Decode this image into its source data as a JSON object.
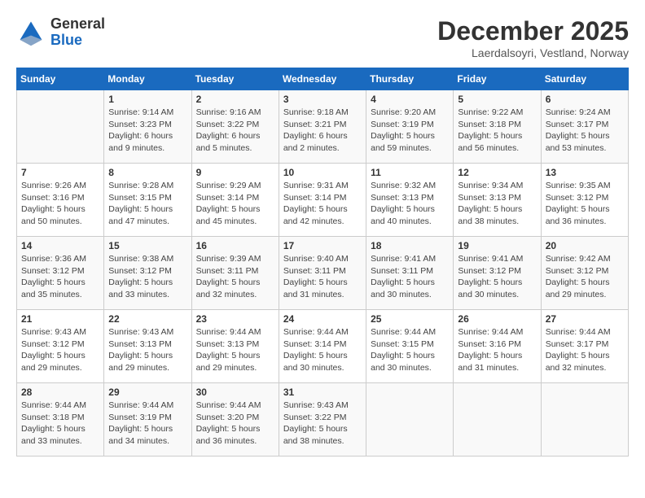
{
  "header": {
    "logo_line1": "General",
    "logo_line2": "Blue",
    "month_title": "December 2025",
    "subtitle": "Laerdalsoyri, Vestland, Norway"
  },
  "calendar": {
    "days_of_week": [
      "Sunday",
      "Monday",
      "Tuesday",
      "Wednesday",
      "Thursday",
      "Friday",
      "Saturday"
    ],
    "weeks": [
      [
        {
          "day": "",
          "info": ""
        },
        {
          "day": "1",
          "info": "Sunrise: 9:14 AM\nSunset: 3:23 PM\nDaylight: 6 hours\nand 9 minutes."
        },
        {
          "day": "2",
          "info": "Sunrise: 9:16 AM\nSunset: 3:22 PM\nDaylight: 6 hours\nand 5 minutes."
        },
        {
          "day": "3",
          "info": "Sunrise: 9:18 AM\nSunset: 3:21 PM\nDaylight: 6 hours\nand 2 minutes."
        },
        {
          "day": "4",
          "info": "Sunrise: 9:20 AM\nSunset: 3:19 PM\nDaylight: 5 hours\nand 59 minutes."
        },
        {
          "day": "5",
          "info": "Sunrise: 9:22 AM\nSunset: 3:18 PM\nDaylight: 5 hours\nand 56 minutes."
        },
        {
          "day": "6",
          "info": "Sunrise: 9:24 AM\nSunset: 3:17 PM\nDaylight: 5 hours\nand 53 minutes."
        }
      ],
      [
        {
          "day": "7",
          "info": "Sunrise: 9:26 AM\nSunset: 3:16 PM\nDaylight: 5 hours\nand 50 minutes."
        },
        {
          "day": "8",
          "info": "Sunrise: 9:28 AM\nSunset: 3:15 PM\nDaylight: 5 hours\nand 47 minutes."
        },
        {
          "day": "9",
          "info": "Sunrise: 9:29 AM\nSunset: 3:14 PM\nDaylight: 5 hours\nand 45 minutes."
        },
        {
          "day": "10",
          "info": "Sunrise: 9:31 AM\nSunset: 3:14 PM\nDaylight: 5 hours\nand 42 minutes."
        },
        {
          "day": "11",
          "info": "Sunrise: 9:32 AM\nSunset: 3:13 PM\nDaylight: 5 hours\nand 40 minutes."
        },
        {
          "day": "12",
          "info": "Sunrise: 9:34 AM\nSunset: 3:13 PM\nDaylight: 5 hours\nand 38 minutes."
        },
        {
          "day": "13",
          "info": "Sunrise: 9:35 AM\nSunset: 3:12 PM\nDaylight: 5 hours\nand 36 minutes."
        }
      ],
      [
        {
          "day": "14",
          "info": "Sunrise: 9:36 AM\nSunset: 3:12 PM\nDaylight: 5 hours\nand 35 minutes."
        },
        {
          "day": "15",
          "info": "Sunrise: 9:38 AM\nSunset: 3:12 PM\nDaylight: 5 hours\nand 33 minutes."
        },
        {
          "day": "16",
          "info": "Sunrise: 9:39 AM\nSunset: 3:11 PM\nDaylight: 5 hours\nand 32 minutes."
        },
        {
          "day": "17",
          "info": "Sunrise: 9:40 AM\nSunset: 3:11 PM\nDaylight: 5 hours\nand 31 minutes."
        },
        {
          "day": "18",
          "info": "Sunrise: 9:41 AM\nSunset: 3:11 PM\nDaylight: 5 hours\nand 30 minutes."
        },
        {
          "day": "19",
          "info": "Sunrise: 9:41 AM\nSunset: 3:12 PM\nDaylight: 5 hours\nand 30 minutes."
        },
        {
          "day": "20",
          "info": "Sunrise: 9:42 AM\nSunset: 3:12 PM\nDaylight: 5 hours\nand 29 minutes."
        }
      ],
      [
        {
          "day": "21",
          "info": "Sunrise: 9:43 AM\nSunset: 3:12 PM\nDaylight: 5 hours\nand 29 minutes."
        },
        {
          "day": "22",
          "info": "Sunrise: 9:43 AM\nSunset: 3:13 PM\nDaylight: 5 hours\nand 29 minutes."
        },
        {
          "day": "23",
          "info": "Sunrise: 9:44 AM\nSunset: 3:13 PM\nDaylight: 5 hours\nand 29 minutes."
        },
        {
          "day": "24",
          "info": "Sunrise: 9:44 AM\nSunset: 3:14 PM\nDaylight: 5 hours\nand 30 minutes."
        },
        {
          "day": "25",
          "info": "Sunrise: 9:44 AM\nSunset: 3:15 PM\nDaylight: 5 hours\nand 30 minutes."
        },
        {
          "day": "26",
          "info": "Sunrise: 9:44 AM\nSunset: 3:16 PM\nDaylight: 5 hours\nand 31 minutes."
        },
        {
          "day": "27",
          "info": "Sunrise: 9:44 AM\nSunset: 3:17 PM\nDaylight: 5 hours\nand 32 minutes."
        }
      ],
      [
        {
          "day": "28",
          "info": "Sunrise: 9:44 AM\nSunset: 3:18 PM\nDaylight: 5 hours\nand 33 minutes."
        },
        {
          "day": "29",
          "info": "Sunrise: 9:44 AM\nSunset: 3:19 PM\nDaylight: 5 hours\nand 34 minutes."
        },
        {
          "day": "30",
          "info": "Sunrise: 9:44 AM\nSunset: 3:20 PM\nDaylight: 5 hours\nand 36 minutes."
        },
        {
          "day": "31",
          "info": "Sunrise: 9:43 AM\nSunset: 3:22 PM\nDaylight: 5 hours\nand 38 minutes."
        },
        {
          "day": "",
          "info": ""
        },
        {
          "day": "",
          "info": ""
        },
        {
          "day": "",
          "info": ""
        }
      ]
    ]
  }
}
